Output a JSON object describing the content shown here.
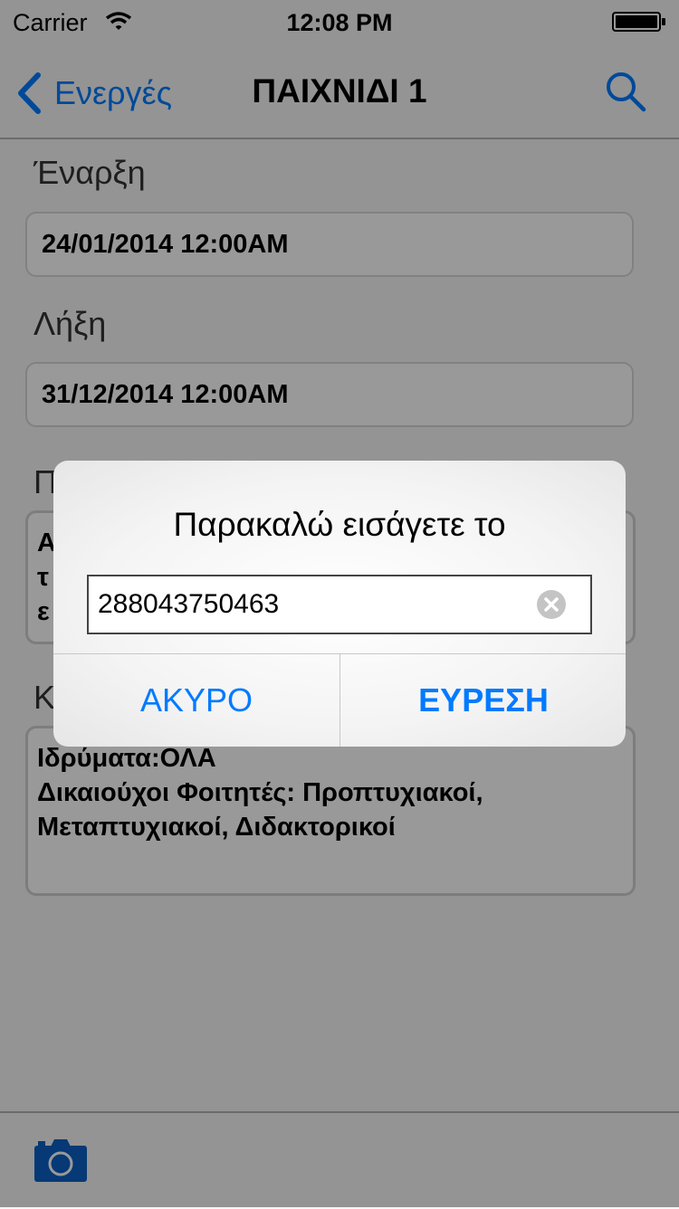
{
  "status_bar": {
    "carrier": "Carrier",
    "time": "12:08 PM"
  },
  "nav": {
    "back_label": "Ενεργές",
    "title": "ΠΑΙΧΝΙΔΙ 1"
  },
  "fields": {
    "start_label": "Έναρξη",
    "start_value": "24/01/2014 12:00AM",
    "end_label": "Λήξη",
    "end_value": "31/12/2014 12:00AM",
    "third_label": "Π",
    "third_value_line1": "Α",
    "third_value_line2": "τ",
    "third_value_line3": "ε",
    "fourth_label": "Κ",
    "fourth_value_line1": "Ιδρύματα:ΟΛΑ",
    "fourth_value_line2": "Δικαιούχοι Φοιτητές: Προπτυχιακοί,",
    "fourth_value_line3": "Μεταπτυχιακοί, Διδακτορικοί"
  },
  "alert": {
    "title": "Παρακαλώ εισάγετε το",
    "input_value": "288043750463",
    "cancel_label": "ΑΚΥΡΟ",
    "find_label": "ΕΥΡΕΣΗ"
  },
  "colors": {
    "accent": "#007aff",
    "camera": "#0a5fc4"
  },
  "icons": [
    "wifi-icon",
    "battery-icon",
    "chevron-left-icon",
    "search-icon",
    "clear-icon",
    "camera-icon"
  ]
}
